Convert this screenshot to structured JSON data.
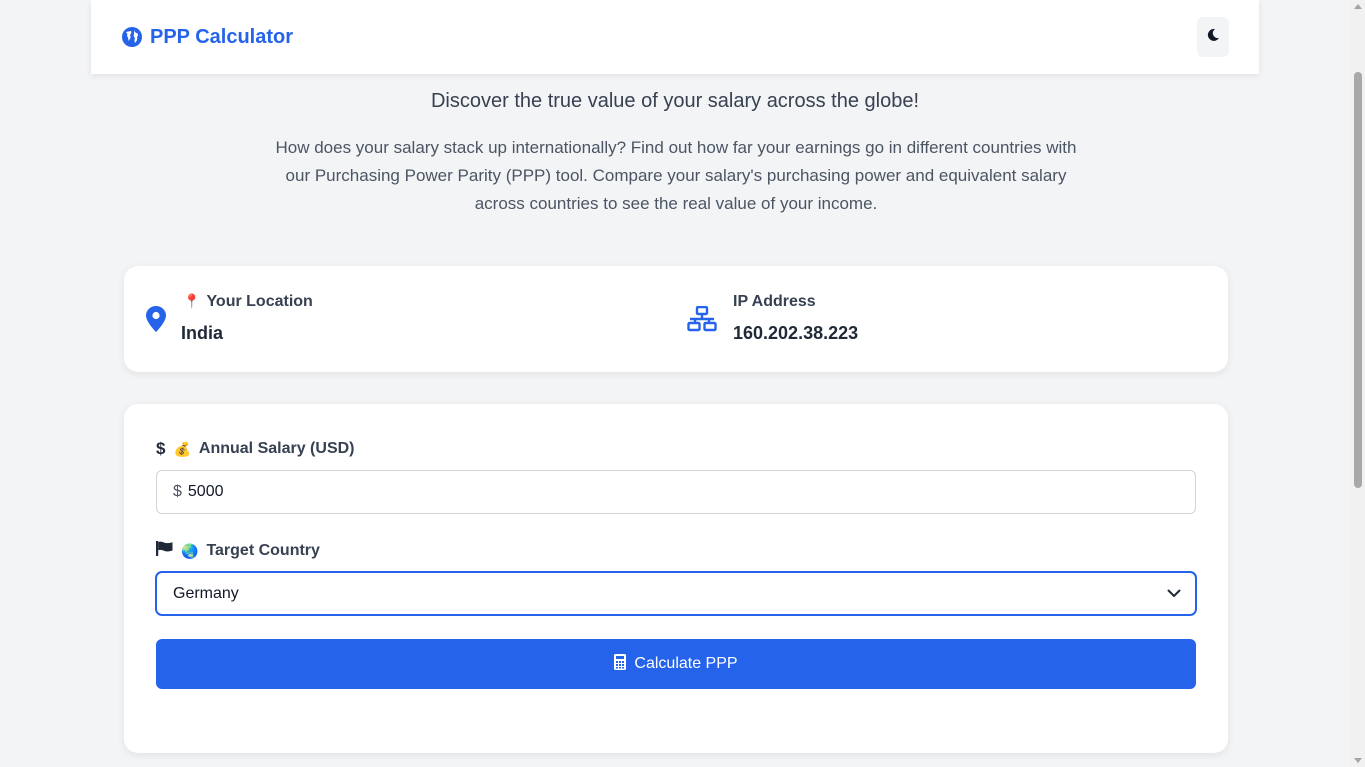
{
  "header": {
    "brand": "PPP Calculator",
    "brand_icon": "globe-icon",
    "theme_toggle_icon": "moon-icon",
    "accent": "#2563eb"
  },
  "intro": {
    "tagline": "Discover the true value of your salary across the globe!",
    "description": "How does your salary stack up internationally? Find out how far your earnings go in different countries with our Purchasing Power Parity (PPP) tool. Compare your salary's purchasing power and equivalent salary across countries to see the real value of your income."
  },
  "info": {
    "location_label": "Your Location",
    "location_emoji": "📍",
    "location_value": "India",
    "ip_label": "IP Address",
    "ip_value": "160.202.38.223"
  },
  "form": {
    "salary_label": "Annual Salary (USD)",
    "salary_emoji": "💰",
    "currency_symbol": "$",
    "salary_value": "5000",
    "country_label": "Target Country",
    "country_emoji": "🌏",
    "country_selected": "Germany",
    "calculate_label": "Calculate PPP"
  }
}
